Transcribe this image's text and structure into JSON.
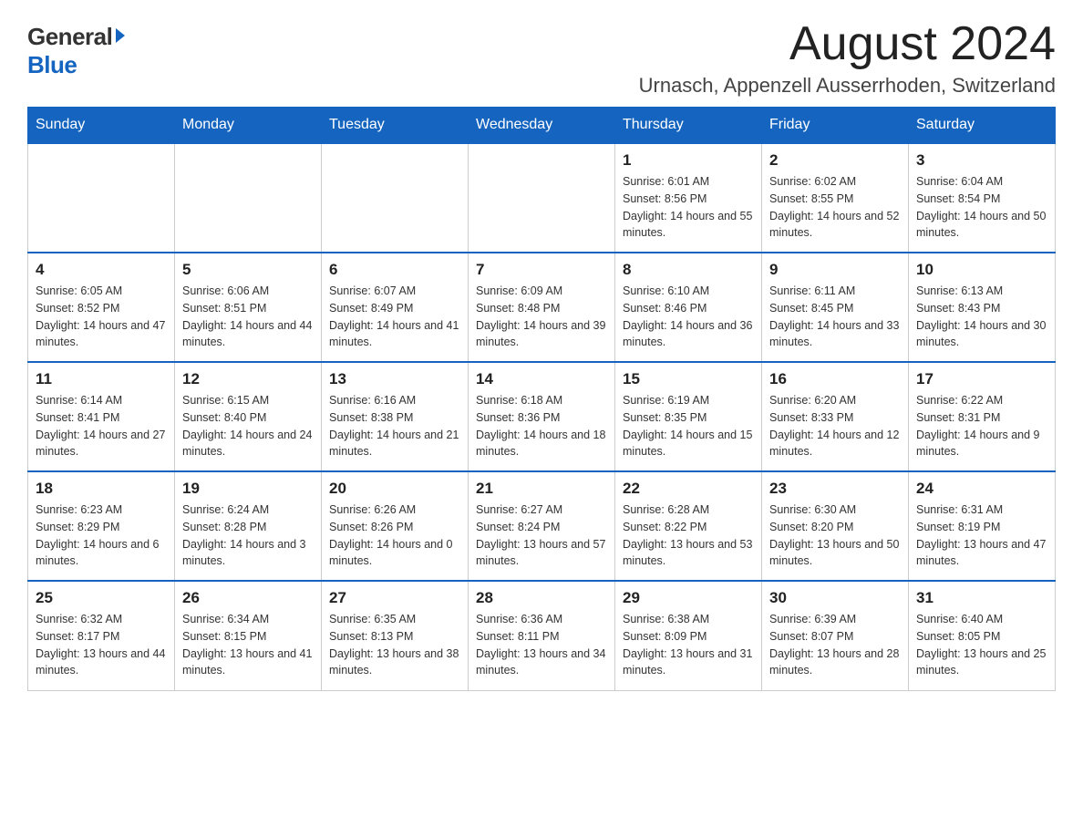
{
  "logo": {
    "general": "General",
    "blue": "Blue"
  },
  "header": {
    "month_year": "August 2024",
    "location": "Urnasch, Appenzell Ausserrhoden, Switzerland"
  },
  "days_of_week": [
    "Sunday",
    "Monday",
    "Tuesday",
    "Wednesday",
    "Thursday",
    "Friday",
    "Saturday"
  ],
  "weeks": [
    [
      {
        "day": "",
        "sunrise": "",
        "sunset": "",
        "daylight": ""
      },
      {
        "day": "",
        "sunrise": "",
        "sunset": "",
        "daylight": ""
      },
      {
        "day": "",
        "sunrise": "",
        "sunset": "",
        "daylight": ""
      },
      {
        "day": "",
        "sunrise": "",
        "sunset": "",
        "daylight": ""
      },
      {
        "day": "1",
        "sunrise": "Sunrise: 6:01 AM",
        "sunset": "Sunset: 8:56 PM",
        "daylight": "Daylight: 14 hours and 55 minutes."
      },
      {
        "day": "2",
        "sunrise": "Sunrise: 6:02 AM",
        "sunset": "Sunset: 8:55 PM",
        "daylight": "Daylight: 14 hours and 52 minutes."
      },
      {
        "day": "3",
        "sunrise": "Sunrise: 6:04 AM",
        "sunset": "Sunset: 8:54 PM",
        "daylight": "Daylight: 14 hours and 50 minutes."
      }
    ],
    [
      {
        "day": "4",
        "sunrise": "Sunrise: 6:05 AM",
        "sunset": "Sunset: 8:52 PM",
        "daylight": "Daylight: 14 hours and 47 minutes."
      },
      {
        "day": "5",
        "sunrise": "Sunrise: 6:06 AM",
        "sunset": "Sunset: 8:51 PM",
        "daylight": "Daylight: 14 hours and 44 minutes."
      },
      {
        "day": "6",
        "sunrise": "Sunrise: 6:07 AM",
        "sunset": "Sunset: 8:49 PM",
        "daylight": "Daylight: 14 hours and 41 minutes."
      },
      {
        "day": "7",
        "sunrise": "Sunrise: 6:09 AM",
        "sunset": "Sunset: 8:48 PM",
        "daylight": "Daylight: 14 hours and 39 minutes."
      },
      {
        "day": "8",
        "sunrise": "Sunrise: 6:10 AM",
        "sunset": "Sunset: 8:46 PM",
        "daylight": "Daylight: 14 hours and 36 minutes."
      },
      {
        "day": "9",
        "sunrise": "Sunrise: 6:11 AM",
        "sunset": "Sunset: 8:45 PM",
        "daylight": "Daylight: 14 hours and 33 minutes."
      },
      {
        "day": "10",
        "sunrise": "Sunrise: 6:13 AM",
        "sunset": "Sunset: 8:43 PM",
        "daylight": "Daylight: 14 hours and 30 minutes."
      }
    ],
    [
      {
        "day": "11",
        "sunrise": "Sunrise: 6:14 AM",
        "sunset": "Sunset: 8:41 PM",
        "daylight": "Daylight: 14 hours and 27 minutes."
      },
      {
        "day": "12",
        "sunrise": "Sunrise: 6:15 AM",
        "sunset": "Sunset: 8:40 PM",
        "daylight": "Daylight: 14 hours and 24 minutes."
      },
      {
        "day": "13",
        "sunrise": "Sunrise: 6:16 AM",
        "sunset": "Sunset: 8:38 PM",
        "daylight": "Daylight: 14 hours and 21 minutes."
      },
      {
        "day": "14",
        "sunrise": "Sunrise: 6:18 AM",
        "sunset": "Sunset: 8:36 PM",
        "daylight": "Daylight: 14 hours and 18 minutes."
      },
      {
        "day": "15",
        "sunrise": "Sunrise: 6:19 AM",
        "sunset": "Sunset: 8:35 PM",
        "daylight": "Daylight: 14 hours and 15 minutes."
      },
      {
        "day": "16",
        "sunrise": "Sunrise: 6:20 AM",
        "sunset": "Sunset: 8:33 PM",
        "daylight": "Daylight: 14 hours and 12 minutes."
      },
      {
        "day": "17",
        "sunrise": "Sunrise: 6:22 AM",
        "sunset": "Sunset: 8:31 PM",
        "daylight": "Daylight: 14 hours and 9 minutes."
      }
    ],
    [
      {
        "day": "18",
        "sunrise": "Sunrise: 6:23 AM",
        "sunset": "Sunset: 8:29 PM",
        "daylight": "Daylight: 14 hours and 6 minutes."
      },
      {
        "day": "19",
        "sunrise": "Sunrise: 6:24 AM",
        "sunset": "Sunset: 8:28 PM",
        "daylight": "Daylight: 14 hours and 3 minutes."
      },
      {
        "day": "20",
        "sunrise": "Sunrise: 6:26 AM",
        "sunset": "Sunset: 8:26 PM",
        "daylight": "Daylight: 14 hours and 0 minutes."
      },
      {
        "day": "21",
        "sunrise": "Sunrise: 6:27 AM",
        "sunset": "Sunset: 8:24 PM",
        "daylight": "Daylight: 13 hours and 57 minutes."
      },
      {
        "day": "22",
        "sunrise": "Sunrise: 6:28 AM",
        "sunset": "Sunset: 8:22 PM",
        "daylight": "Daylight: 13 hours and 53 minutes."
      },
      {
        "day": "23",
        "sunrise": "Sunrise: 6:30 AM",
        "sunset": "Sunset: 8:20 PM",
        "daylight": "Daylight: 13 hours and 50 minutes."
      },
      {
        "day": "24",
        "sunrise": "Sunrise: 6:31 AM",
        "sunset": "Sunset: 8:19 PM",
        "daylight": "Daylight: 13 hours and 47 minutes."
      }
    ],
    [
      {
        "day": "25",
        "sunrise": "Sunrise: 6:32 AM",
        "sunset": "Sunset: 8:17 PM",
        "daylight": "Daylight: 13 hours and 44 minutes."
      },
      {
        "day": "26",
        "sunrise": "Sunrise: 6:34 AM",
        "sunset": "Sunset: 8:15 PM",
        "daylight": "Daylight: 13 hours and 41 minutes."
      },
      {
        "day": "27",
        "sunrise": "Sunrise: 6:35 AM",
        "sunset": "Sunset: 8:13 PM",
        "daylight": "Daylight: 13 hours and 38 minutes."
      },
      {
        "day": "28",
        "sunrise": "Sunrise: 6:36 AM",
        "sunset": "Sunset: 8:11 PM",
        "daylight": "Daylight: 13 hours and 34 minutes."
      },
      {
        "day": "29",
        "sunrise": "Sunrise: 6:38 AM",
        "sunset": "Sunset: 8:09 PM",
        "daylight": "Daylight: 13 hours and 31 minutes."
      },
      {
        "day": "30",
        "sunrise": "Sunrise: 6:39 AM",
        "sunset": "Sunset: 8:07 PM",
        "daylight": "Daylight: 13 hours and 28 minutes."
      },
      {
        "day": "31",
        "sunrise": "Sunrise: 6:40 AM",
        "sunset": "Sunset: 8:05 PM",
        "daylight": "Daylight: 13 hours and 25 minutes."
      }
    ]
  ]
}
